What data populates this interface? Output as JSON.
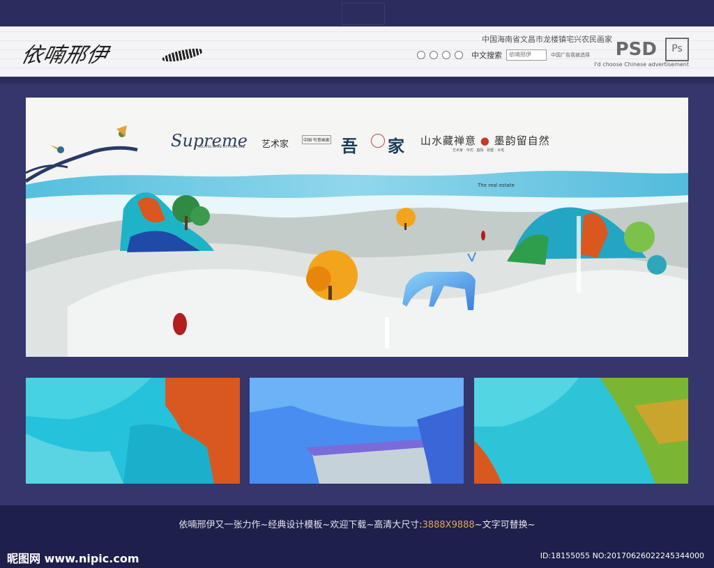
{
  "header": {
    "brand": "依喃邢伊",
    "description": "中国海南省文昌市龙楼镇宅兴农民画家",
    "search_label": "中文搜索",
    "search_value": "依喃邢伊",
    "search_hint": "中国广告我被选择",
    "format": "PSD",
    "ps_badge": "Ps",
    "tagline": "I'd choose Chinese advertisement"
  },
  "hero": {
    "logo_main": "Supreme",
    "logo_sub": "LOCATED IN THE CITY AXIAL LINE",
    "art_name": "艺术家",
    "small_badge": "中国·写意画家",
    "project_a": "吾",
    "project_b": "家",
    "slogan_a": "山水藏禅意",
    "slogan_b": "墨韵留自然",
    "slogan_sub": "艺术家 · 中式 · 庭院 · 别墅 · 大宅",
    "realestate": "The real estate"
  },
  "footer": {
    "caption_pre": "依喃邢伊又一张力作~经典设计模板~欢迎下载~高清大尺寸:",
    "caption_size": "3888X9888",
    "caption_post": "~文字可替换~",
    "site": "昵图网 www.nipic.com",
    "id_text": "ID:18155055 NO:20170626022245344000"
  },
  "colors": {
    "background": "#2a2b5a",
    "panel": "#34366c",
    "turquoise": "#2ec4d8",
    "orange": "#d9581f",
    "gold": "#f2a51c"
  }
}
